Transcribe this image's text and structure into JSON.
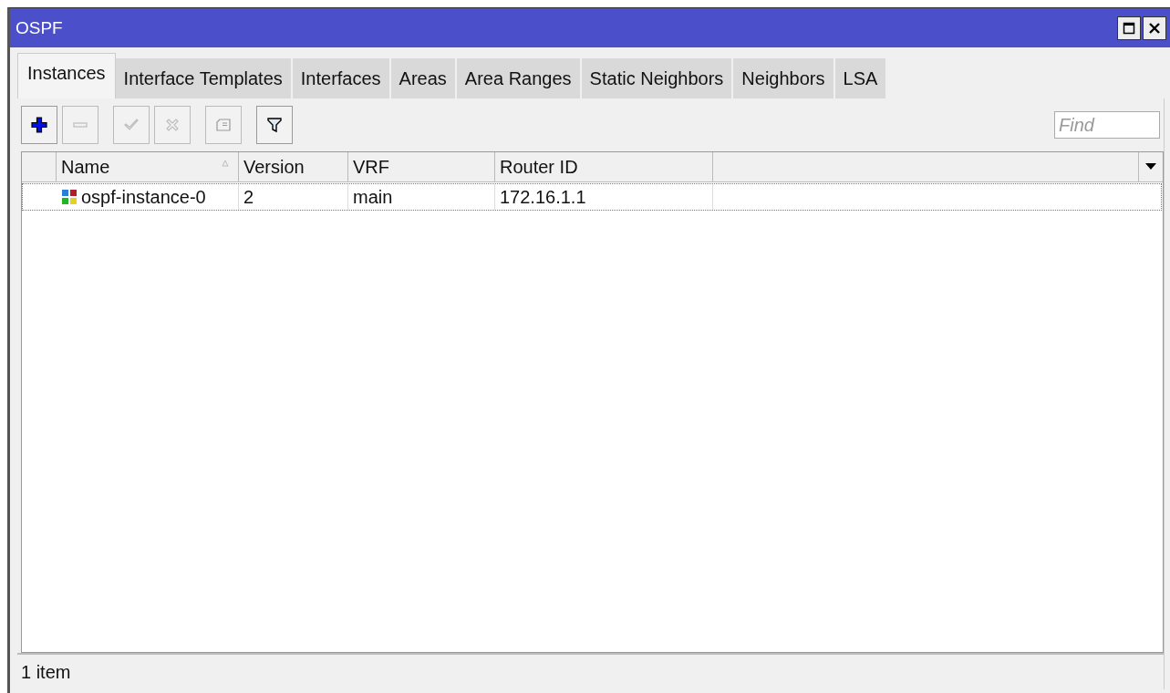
{
  "window": {
    "title": "OSPF"
  },
  "tabs": [
    {
      "label": "Instances",
      "selected": true
    },
    {
      "label": "Interface Templates",
      "selected": false
    },
    {
      "label": "Interfaces",
      "selected": false
    },
    {
      "label": "Areas",
      "selected": false
    },
    {
      "label": "Area Ranges",
      "selected": false
    },
    {
      "label": "Static Neighbors",
      "selected": false
    },
    {
      "label": "Neighbors",
      "selected": false
    },
    {
      "label": "LSA",
      "selected": false
    }
  ],
  "toolbar": [
    {
      "kind": "add",
      "disabled": false
    },
    {
      "kind": "remove",
      "disabled": true
    },
    {
      "kind": "enable",
      "disabled": true
    },
    {
      "kind": "disable",
      "disabled": true
    },
    {
      "kind": "comment",
      "disabled": true
    },
    {
      "kind": "filter",
      "disabled": false
    }
  ],
  "search": {
    "placeholder": "Find"
  },
  "table": {
    "columns": [
      {
        "label": "Name",
        "sorted": true
      },
      {
        "label": "Version",
        "sorted": false
      },
      {
        "label": "VRF",
        "sorted": false
      },
      {
        "label": "Router ID",
        "sorted": false
      }
    ],
    "rows": [
      {
        "cells": [
          "ospf-instance-0",
          "2",
          "main",
          "172.16.1.1"
        ]
      }
    ]
  },
  "status_bar": {
    "text": "1 item"
  }
}
